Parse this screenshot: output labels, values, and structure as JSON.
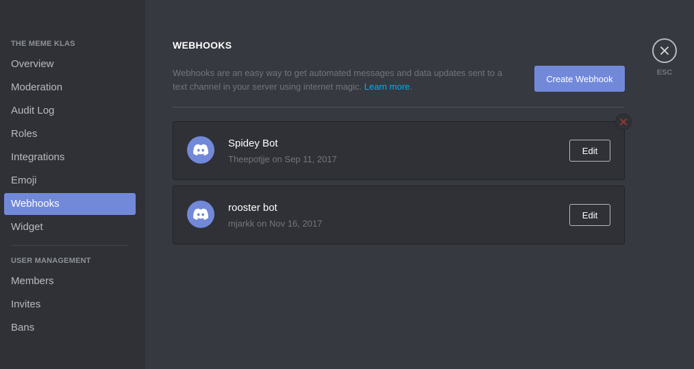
{
  "sidebar": {
    "server_header": "THE MEME KLAS",
    "items": [
      {
        "label": "Overview"
      },
      {
        "label": "Moderation"
      },
      {
        "label": "Audit Log"
      },
      {
        "label": "Roles"
      },
      {
        "label": "Integrations"
      },
      {
        "label": "Emoji"
      },
      {
        "label": "Webhooks",
        "active": true
      },
      {
        "label": "Widget"
      }
    ],
    "user_header": "USER MANAGEMENT",
    "user_items": [
      {
        "label": "Members"
      },
      {
        "label": "Invites"
      },
      {
        "label": "Bans"
      }
    ]
  },
  "main": {
    "title": "WEBHOOKS",
    "description": "Webhooks are an easy way to get automated messages and data updates sent to a text channel in your server using internet magic.",
    "learn_more": "Learn more",
    "period": ".",
    "create_button": "Create Webhook",
    "webhooks": [
      {
        "name": "Spidey Bot",
        "meta": "Theepotjje on Sep 11, 2017",
        "edit_label": "Edit",
        "avatar_icon": "discord-logo-icon"
      },
      {
        "name": "rooster bot",
        "meta": "mjarkk on Nov 16, 2017",
        "edit_label": "Edit",
        "avatar_icon": "discord-logo-icon"
      }
    ]
  },
  "close": {
    "esc_label": "ESC",
    "icon": "close-icon"
  },
  "colors": {
    "accent": "#7289da",
    "link": "#00b0f4",
    "danger": "#f04747"
  }
}
